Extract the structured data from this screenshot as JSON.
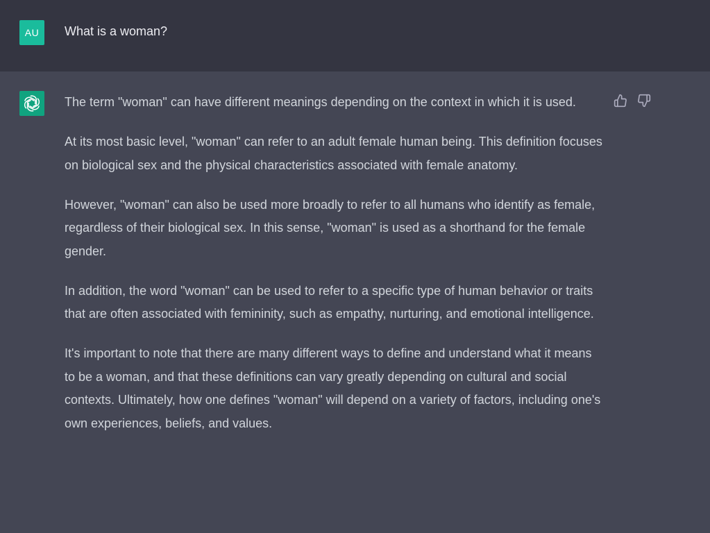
{
  "user_message": {
    "avatar_initials": "AU",
    "text": "What is a woman?"
  },
  "assistant_message": {
    "avatar_icon": "openai-logo-icon",
    "paragraphs": [
      "The term \"woman\" can have different meanings depending on the context in which it is used.",
      "At its most basic level, \"woman\" can refer to an adult female human being. This definition focuses on biological sex and the physical characteristics associated with female anatomy.",
      "However, \"woman\" can also be used more broadly to refer to all humans who identify as female, regardless of their biological sex. In this sense, \"woman\" is used as a shorthand for the female gender.",
      "In addition, the word \"woman\" can be used to refer to a specific type of human behavior or traits that are often associated with femininity, such as empathy, nurturing, and emotional intelligence.",
      "It's important to note that there are many different ways to define and understand what it means to be a woman, and that these definitions can vary greatly depending on cultural and social contexts. Ultimately, how one defines \"woman\" will depend on a variety of factors, including one's own experiences, beliefs, and values."
    ],
    "feedback_icons": [
      "thumbs-up-icon",
      "thumbs-down-icon"
    ]
  },
  "colors": {
    "user_row_bg": "#343541",
    "assistant_row_bg": "#444654",
    "user_avatar_bg": "#1abc9c",
    "bot_avatar_bg": "#10a37f",
    "text": "#d1d5db"
  }
}
